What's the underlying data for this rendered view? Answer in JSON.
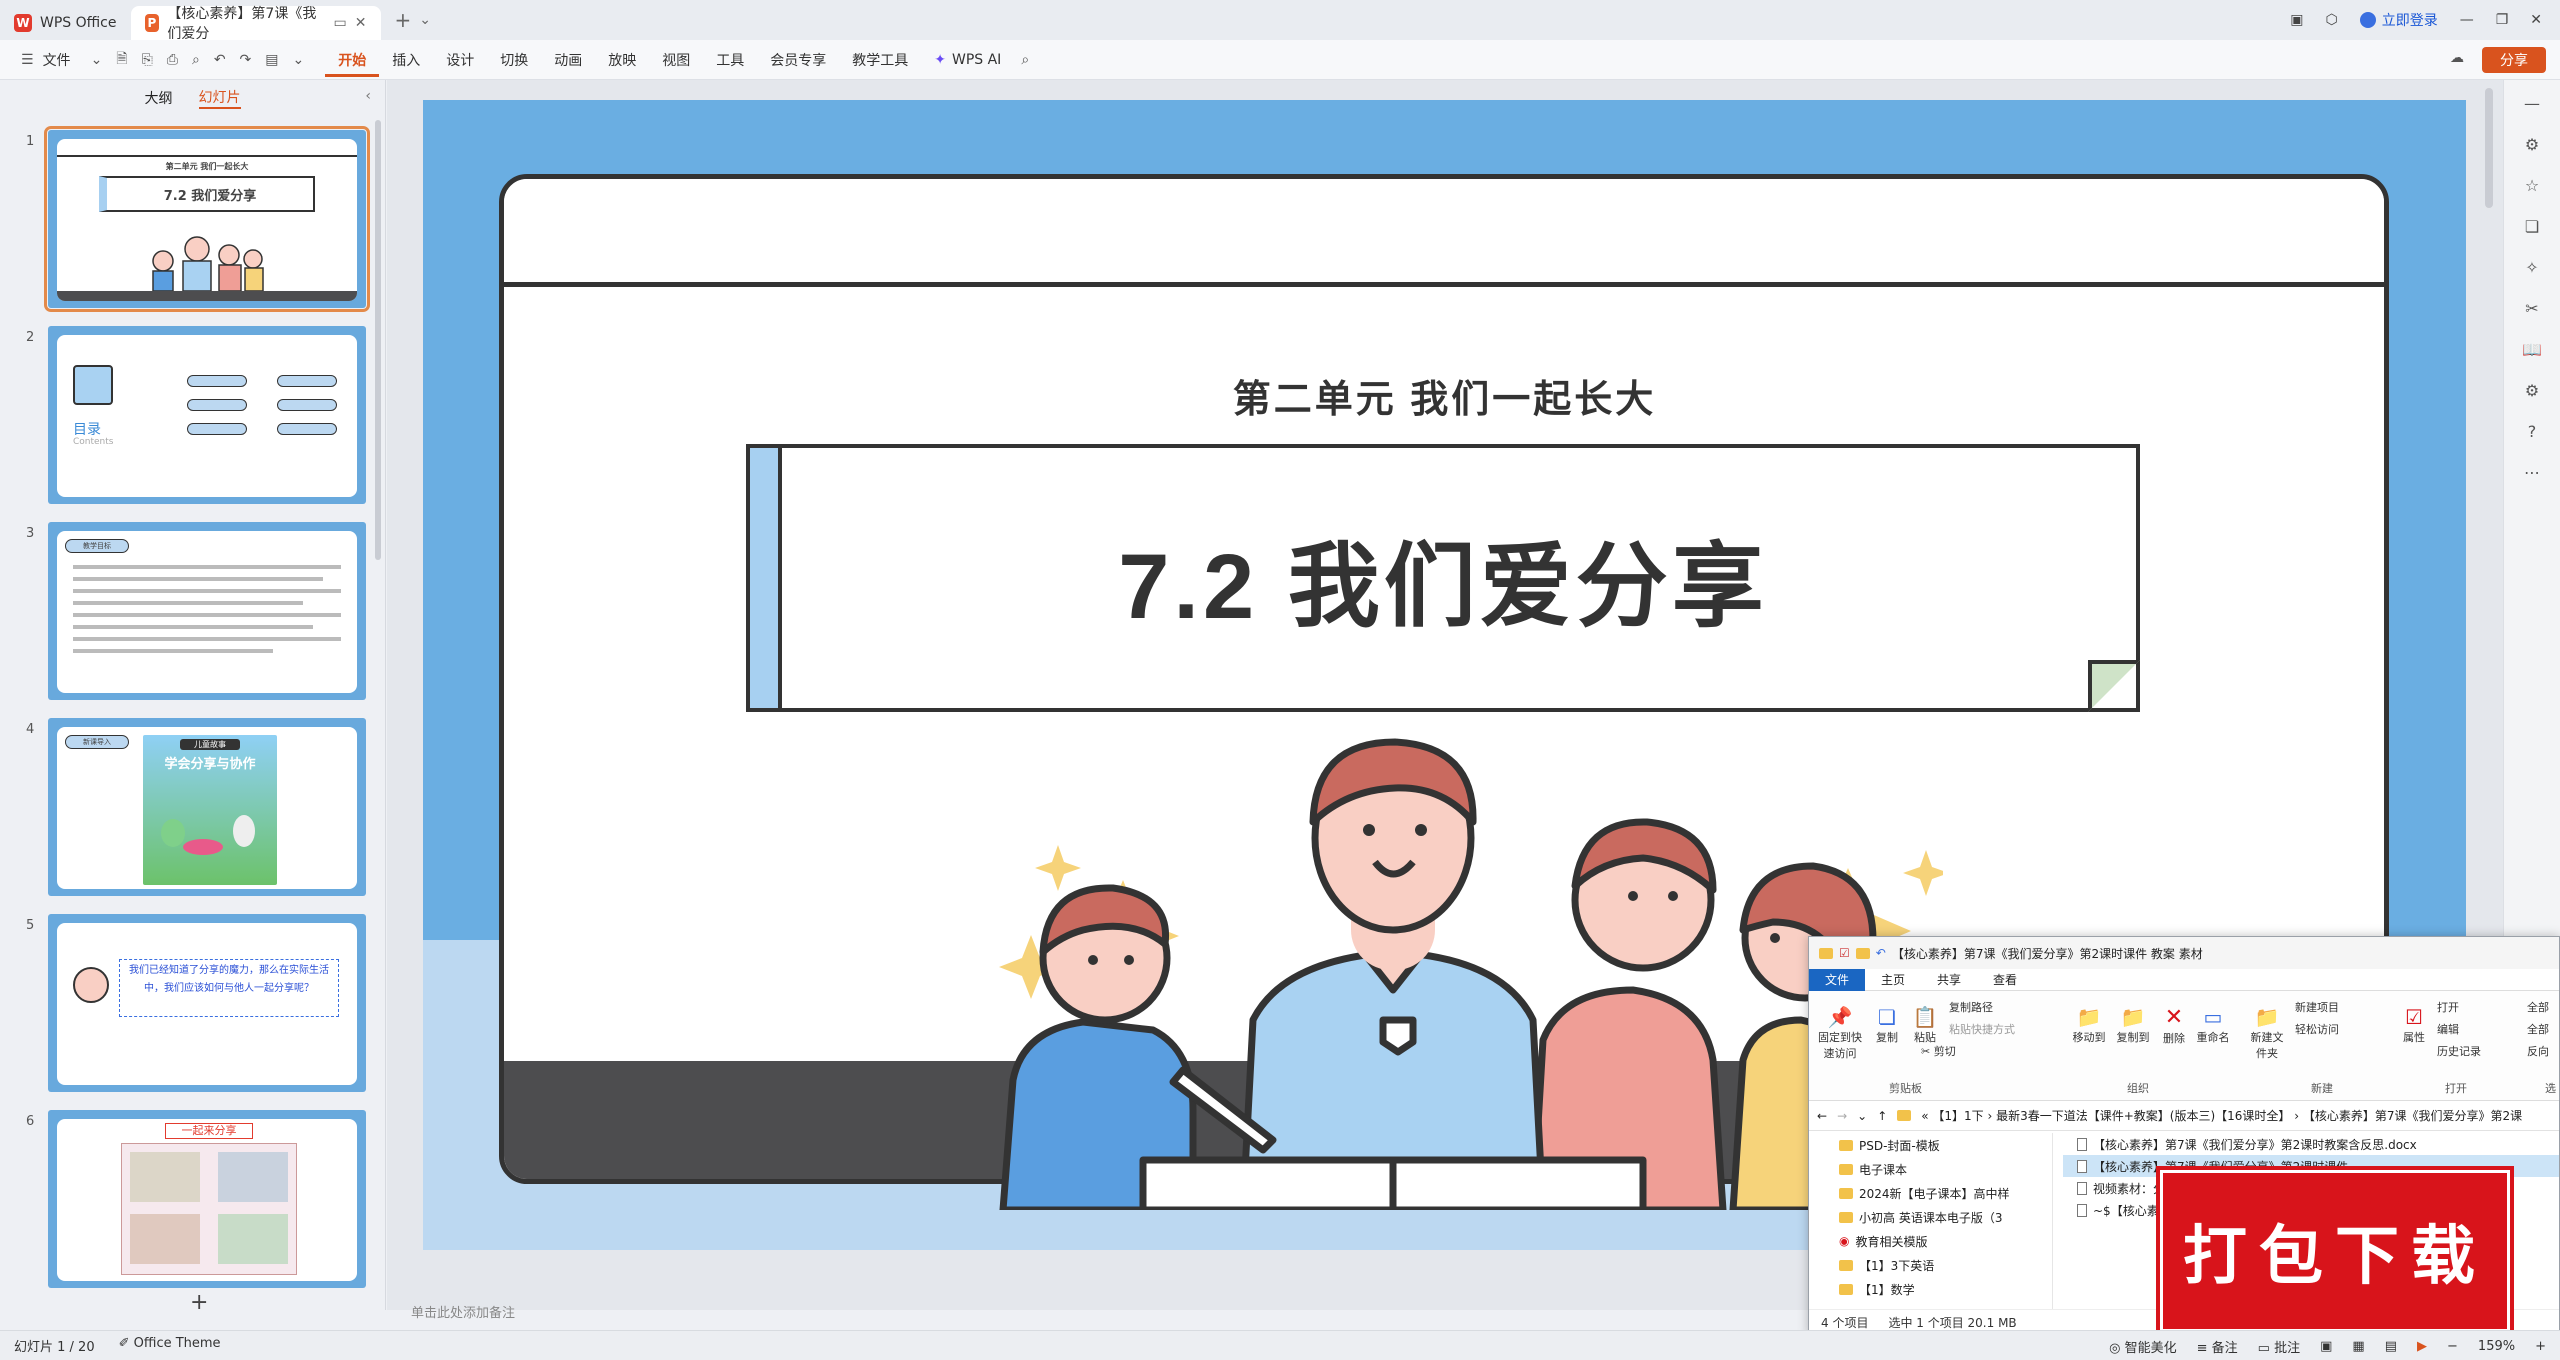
{
  "titlebar": {
    "app_tab": "WPS Office",
    "doc_tab": "【核心素养】第7课《我们爱分",
    "login": "立即登录"
  },
  "ribbon": {
    "file_menu": "文件",
    "tabs": [
      "开始",
      "插入",
      "设计",
      "切换",
      "动画",
      "放映",
      "视图",
      "工具",
      "会员专享",
      "教学工具"
    ],
    "ai": "WPS AI",
    "share": "分享"
  },
  "leftpane": {
    "tab_outline": "大纲",
    "tab_slides": "幻灯片",
    "slides": [
      {
        "num": "1",
        "unit": "第二单元 我们一起长大",
        "title": "7.2 我们爱分享"
      },
      {
        "num": "2",
        "label": "目录",
        "label_en": "Contents"
      },
      {
        "num": "3",
        "label": "教学目标"
      },
      {
        "num": "4",
        "label": "新课导入",
        "book_line1": "儿童故事",
        "book_line2": "学会分享与协作"
      },
      {
        "num": "5",
        "text": "我们已经知道了分享的魔力，那么在实际生活中，我们应该如何与他人一起分享呢？"
      },
      {
        "num": "6",
        "title": "一起来分享"
      }
    ]
  },
  "slide": {
    "subtitle": "第二单元  我们一起长大",
    "title": "7.2  我们爱分享",
    "notes_placeholder": "单击此处添加备注"
  },
  "explorer": {
    "title": "【核心素养】第7课《我们爱分享》第2课时课件 教案 素材",
    "tabs": [
      "文件",
      "主页",
      "共享",
      "查看"
    ],
    "ribbon": {
      "pin": "固定到快速访问",
      "copy": "复制",
      "paste": "粘贴",
      "copy_path": "复制路径",
      "paste_shortcut": "粘贴快捷方式",
      "cut": "剪切",
      "group_clipboard": "剪贴板",
      "move_to": "移动到",
      "copy_to": "复制到",
      "delete": "删除",
      "rename": "重命名",
      "group_organize": "组织",
      "new_folder": "新建文件夹",
      "new_item": "新建项目",
      "easy_access": "轻松访问",
      "group_new": "新建",
      "properties": "属性",
      "open": "打开",
      "edit": "编辑",
      "history": "历史记录",
      "group_open": "打开",
      "select_all": "全部",
      "select_none": "全部",
      "invert": "反向",
      "group_select": "选"
    },
    "address": "« 【1】1下 › 最新3春一下道法【课件+教案】(版本三)【16课时全】 › 【核心素养】第7课《我们爱分享》第2课",
    "left_items": [
      "PSD-封面-模板",
      "电子课本",
      "2024新【电子课本】高中样",
      "小初高 英语课本电子版（3",
      "教育相关模版",
      "【1】3下英语",
      "【1】数学"
    ],
    "right_items": [
      "【核心素养】第7课《我们爱分享》第2课时教案含反思.docx",
      "【核心素养】第7课《我们爱分享》第2课时课件",
      "视频素材：分享",
      "~$【核心素"
    ],
    "status_count": "4 个项目",
    "status_selected": "选中 1 个项目  20.1 MB"
  },
  "download_stamp": "打包下载",
  "statusbar": {
    "slide_pos": "幻灯片 1 / 20",
    "theme": "Office Theme",
    "beautify": "智能美化",
    "notes": "备注",
    "comments": "批注",
    "zoom": "159%"
  },
  "colors": {
    "accent": "#d9531e",
    "slide_bg": "#6aaee2",
    "stamp": "#d8141b"
  }
}
